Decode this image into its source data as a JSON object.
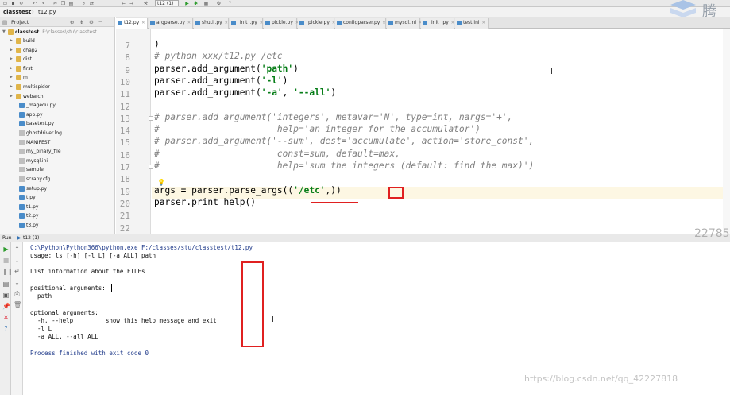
{
  "toolbar": {
    "run_config": "t12 (1)"
  },
  "breadcrumb": {
    "project": "classtest",
    "file": "t12.py"
  },
  "logo": {
    "text": "腾"
  },
  "project_panel": {
    "title": "Project",
    "root_name": "classtest",
    "root_path": "F:\\classes\\stu\\classtest",
    "items": [
      {
        "label": "build",
        "type": "folder"
      },
      {
        "label": "chap2",
        "type": "folder"
      },
      {
        "label": "dist",
        "type": "folder"
      },
      {
        "label": "first",
        "type": "folder"
      },
      {
        "label": "m",
        "type": "folder"
      },
      {
        "label": "multispider",
        "type": "folder"
      },
      {
        "label": "webarch",
        "type": "folder"
      },
      {
        "label": "_magedu.py",
        "type": "py"
      },
      {
        "label": "app.py",
        "type": "py"
      },
      {
        "label": "basetest.py",
        "type": "py"
      },
      {
        "label": "ghostdriver.log",
        "type": "txt"
      },
      {
        "label": "MANIFEST",
        "type": "txt"
      },
      {
        "label": "my_binary_file",
        "type": "txt"
      },
      {
        "label": "mysql.ini",
        "type": "txt"
      },
      {
        "label": "sample",
        "type": "txt"
      },
      {
        "label": "scrapy.cfg",
        "type": "txt"
      },
      {
        "label": "setup.py",
        "type": "py"
      },
      {
        "label": "t.py",
        "type": "py"
      },
      {
        "label": "t1.py",
        "type": "py"
      },
      {
        "label": "t2.py",
        "type": "py"
      },
      {
        "label": "t3.py",
        "type": "py"
      }
    ]
  },
  "tabs": [
    {
      "label": "t12.py",
      "active": true
    },
    {
      "label": "argparse.py",
      "active": false
    },
    {
      "label": "shutil.py",
      "active": false
    },
    {
      "label": "_init_.py",
      "active": false
    },
    {
      "label": "pickle.py",
      "active": false
    },
    {
      "label": "_pickle.py",
      "active": false
    },
    {
      "label": "configparser.py",
      "active": false
    },
    {
      "label": "mysql.ini",
      "active": false
    },
    {
      "label": "_init_.py",
      "active": false
    },
    {
      "label": "test.ini",
      "active": false
    }
  ],
  "editor": {
    "line_numbers": [
      "7",
      "8",
      "9",
      "10",
      "11",
      "12",
      "13",
      "14",
      "15",
      "16",
      "17",
      "18",
      "19",
      "20",
      "21",
      "22"
    ],
    "lines": {
      "l7": ")",
      "l8": "# python xxx/t12.py /etc",
      "l9a": "parser.add_argument(",
      "l9b": "'path'",
      "l9c": ")",
      "l10a": "parser.add_argument(",
      "l10b": "'-l'",
      "l10c": ")",
      "l11a": "parser.add_argument(",
      "l11b": "'-a'",
      "l11c": ", ",
      "l11d": "'--all'",
      "l11e": ")",
      "l13": "# parser.add_argument('integers', metavar='N', type=int, nargs='+',",
      "l14": "#                      help='an integer for the accumulator')",
      "l15": "# parser.add_argument('--sum', dest='accumulate', action='store_const',",
      "l16": "#                      const=sum, default=max,",
      "l17": "#                      help='sum the integers (default: find the max)')",
      "l19a": "args = parser.parse_args((",
      "l19b": "'/etc'",
      "l19c": ",))",
      "l20": "parser.print_help()"
    }
  },
  "run_panel": {
    "label_run": "Run",
    "label_config": "t12 (1)",
    "console": {
      "command": "C:\\Python\\Python366\\python.exe F:/classes/stu/classtest/t12.py",
      "usage": "usage: ls [-h] [-l L] [-a ALL] path",
      "description": "List information about the FILEs",
      "positional_header": "positional arguments:",
      "positional_path": "  path",
      "optional_header": "optional arguments:",
      "opt_help": "  -h, --help         show this help message and exit",
      "opt_l": "  -l L",
      "opt_a": "  -a ALL, --all ALL",
      "exit": "Process finished with exit code 0"
    }
  },
  "watermark": {
    "number": "22785",
    "url": "https://blog.csdn.net/qq_42227818"
  },
  "colors": {
    "annotation_red": "#e02020",
    "string_green": "#067d17",
    "comment_gray": "#808080",
    "console_blue": "#1f3a8a",
    "current_line": "#fdf7e3"
  }
}
